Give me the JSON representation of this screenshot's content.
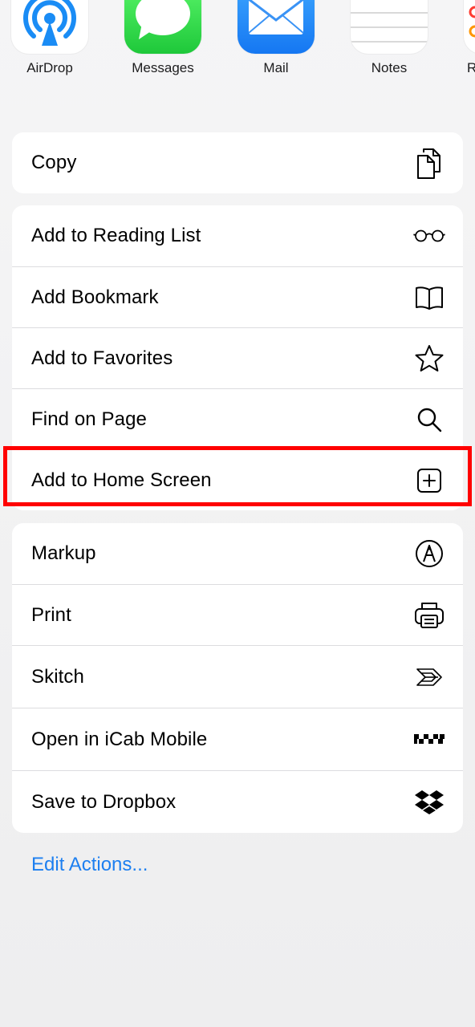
{
  "apps": [
    {
      "name": "AirDrop",
      "icon": "airdrop-icon"
    },
    {
      "name": "Messages",
      "icon": "messages-icon"
    },
    {
      "name": "Mail",
      "icon": "mail-icon"
    },
    {
      "name": "Notes",
      "icon": "notes-icon"
    },
    {
      "name": "R",
      "icon": "reminders-icon"
    }
  ],
  "copy_group": {
    "copy": {
      "label": "Copy",
      "icon": "copy-icon"
    }
  },
  "actions_group": {
    "items": [
      {
        "label": "Add to Reading List",
        "icon": "glasses-icon"
      },
      {
        "label": "Add Bookmark",
        "icon": "book-icon"
      },
      {
        "label": "Add to Favorites",
        "icon": "star-icon"
      },
      {
        "label": "Find on Page",
        "icon": "search-icon"
      },
      {
        "label": "Add to Home Screen",
        "icon": "plus-square-icon"
      }
    ]
  },
  "extensions_group": {
    "items": [
      {
        "label": "Markup",
        "icon": "markup-icon"
      },
      {
        "label": "Print",
        "icon": "printer-icon"
      },
      {
        "label": "Skitch",
        "icon": "skitch-icon"
      },
      {
        "label": "Open in iCab Mobile",
        "icon": "icab-icon"
      },
      {
        "label": "Save to Dropbox",
        "icon": "dropbox-icon"
      }
    ]
  },
  "edit_actions": {
    "label": "Edit Actions..."
  },
  "colors": {
    "accent": "#1d7ff0",
    "highlight": "#ff0000",
    "background": "#f2f2f4"
  }
}
